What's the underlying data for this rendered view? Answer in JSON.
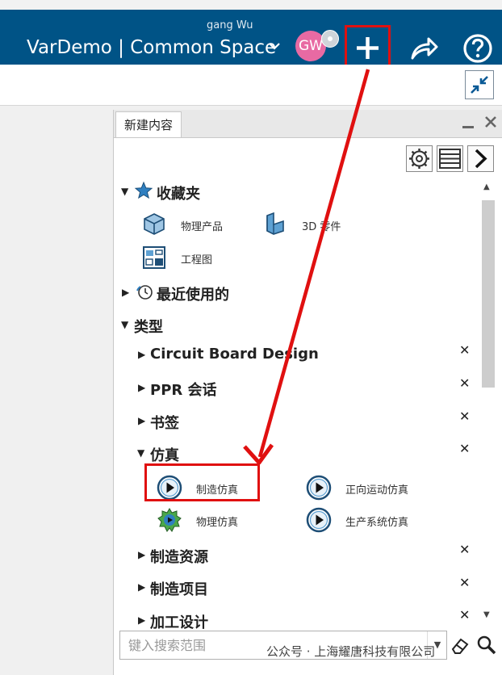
{
  "header": {
    "user_name": "gang Wu",
    "app_title": "VarDemo | Common Space",
    "avatar_initials": "GW",
    "brand_color": "#005386",
    "highlight_color": "#e01010"
  },
  "panel": {
    "tab_label": "新建内容",
    "sections": {
      "favorites": {
        "label": "收藏夹",
        "items": [
          "物理产品",
          "3D 零件",
          "工程图"
        ]
      },
      "recent": {
        "label": "最近使用的"
      },
      "types": {
        "label": "类型",
        "items": [
          "Circuit Board Design",
          "PPR 会话",
          "书签",
          "仿真",
          "制造资源",
          "制造项目",
          "加工设计"
        ],
        "simulation_children": [
          "制造仿真",
          "正向运动仿真",
          "物理仿真",
          "生产系统仿真"
        ]
      }
    }
  },
  "search": {
    "placeholder": "键入搜索范围"
  },
  "watermark": {
    "text": "公众号 · 上海耀唐科技有限公司"
  }
}
